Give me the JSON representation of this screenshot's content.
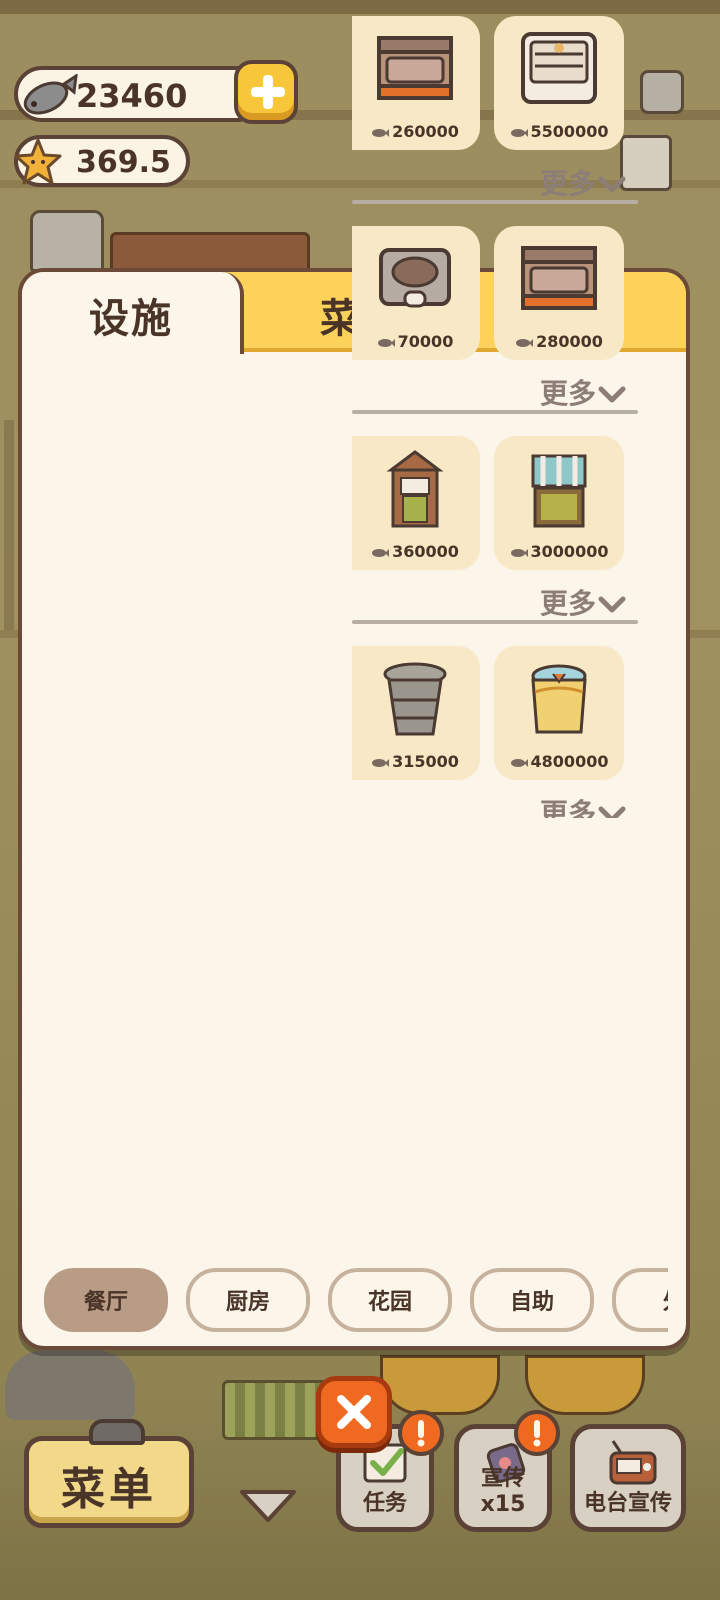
{
  "currency": {
    "fish_amount": "23460",
    "star_amount": "369.5"
  },
  "panel": {
    "tabs": [
      {
        "label": "设施",
        "active": true
      },
      {
        "label": "菜",
        "active": false
      }
    ]
  },
  "shop": {
    "more_label": "更多",
    "rows": [
      {
        "items": [
          {
            "name": "stove-icon",
            "price": "260000"
          },
          {
            "name": "oven-icon",
            "price": "5500000"
          }
        ]
      },
      {
        "items": [
          {
            "name": "grill-icon",
            "price": "70000"
          },
          {
            "name": "stove-icon",
            "price": "280000"
          }
        ]
      },
      {
        "items": [
          {
            "name": "window-icon",
            "price": "360000"
          },
          {
            "name": "curtain-window-icon",
            "price": "3000000"
          }
        ]
      },
      {
        "items": [
          {
            "name": "trash-can-icon",
            "price": "315000"
          },
          {
            "name": "basket-icon",
            "price": "4800000"
          }
        ]
      }
    ]
  },
  "categories": [
    {
      "label": "餐厅",
      "active": true
    },
    {
      "label": "厨房",
      "active": false
    },
    {
      "label": "花园",
      "active": false
    },
    {
      "label": "自助",
      "active": false
    },
    {
      "label": "外",
      "active": false
    }
  ],
  "bottom_bar": {
    "menu_label": "菜单",
    "task_label": "任务",
    "promo_label": "宣传x15",
    "radio_label": "电台宣传"
  },
  "colors": {
    "accent_yellow": "#fdd25a",
    "panel_bg": "#fbf5ea",
    "card_bg": "#f7e8c6",
    "close_orange": "#ef6a20",
    "text_brown": "#4a3428"
  }
}
